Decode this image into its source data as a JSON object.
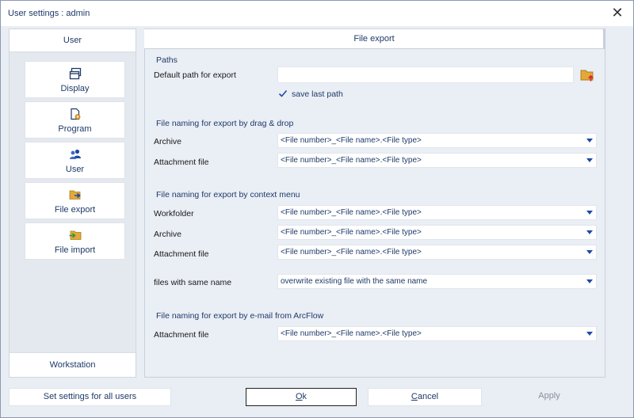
{
  "window": {
    "title": "User settings : admin"
  },
  "left": {
    "user_tab": "User",
    "items": [
      {
        "label": "Display",
        "icon": "window-icon"
      },
      {
        "label": "Program",
        "icon": "document-gear-icon"
      },
      {
        "label": "User",
        "icon": "users-icon"
      },
      {
        "label": "File export",
        "icon": "folder-export-icon"
      },
      {
        "label": "File import",
        "icon": "folder-import-icon"
      }
    ],
    "workstation_tab": "Workstation"
  },
  "main": {
    "header": "File export",
    "paths": {
      "title": "Paths",
      "default_path_label": "Default path for export",
      "default_path_value": "",
      "save_last_path_label": "save last path",
      "save_last_path_checked": true
    },
    "drag_drop": {
      "title": "File naming for export by drag & drop",
      "rows": [
        {
          "label": "Archive",
          "value": "<File number>_<File name>.<File type>"
        },
        {
          "label": "Attachment file",
          "value": "<File number>_<File name>.<File type>"
        }
      ]
    },
    "context_menu": {
      "title": "File naming for export by context menu",
      "rows": [
        {
          "label": "Workfolder",
          "value": "<File number>_<File name>.<File type>"
        },
        {
          "label": "Archive",
          "value": "<File number>_<File name>.<File type>"
        },
        {
          "label": "Attachment file",
          "value": "<File number>_<File name>.<File type>"
        }
      ],
      "same_name_label": "files with same name",
      "same_name_value": "overwrite existing file with the same name"
    },
    "email": {
      "title": "File naming for export by e-mail from ArcFlow",
      "rows": [
        {
          "label": "Attachment file",
          "value": "<File number>_<File name>.<File type>"
        }
      ]
    }
  },
  "buttons": {
    "set_all": "Set settings for all users",
    "ok_first": "O",
    "ok_rest": "k",
    "cancel_first": "C",
    "cancel_rest": "ancel",
    "apply": "Apply"
  },
  "colors": {
    "accent": "#1f3a68",
    "icon_blue": "#1f4aa0",
    "folder": "#e2a93a",
    "arrow_red": "#d8262c"
  }
}
